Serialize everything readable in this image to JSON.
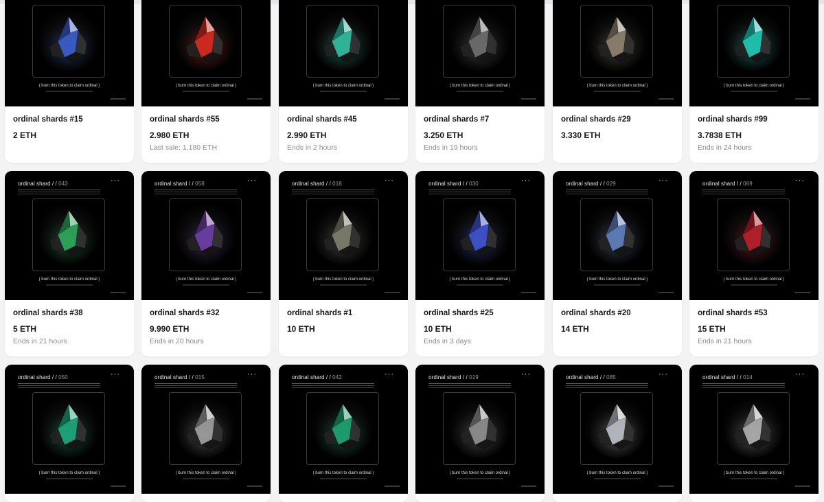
{
  "cards": [
    {
      "name": "ordinal shards #15",
      "price": "2 ETH",
      "sub": "",
      "header": "",
      "num": "",
      "gem": "blue-crystal-image",
      "tint": "#3a5cc4"
    },
    {
      "name": "ordinal shards #55",
      "price": "2.980 ETH",
      "sub": "Last sale: 1.180 ETH",
      "header": "",
      "num": "",
      "gem": "red-crystal-image",
      "tint": "#d12a1f"
    },
    {
      "name": "ordinal shards #45",
      "price": "2.990 ETH",
      "sub": "Ends in 2 hours",
      "header": "",
      "num": "",
      "gem": "teal-crystal-image",
      "tint": "#2fb79a"
    },
    {
      "name": "ordinal shards #7",
      "price": "3.250 ETH",
      "sub": "Ends in 19 hours",
      "header": "",
      "num": "",
      "gem": "black-crystal-image",
      "tint": "#6b6b6b"
    },
    {
      "name": "ordinal shards #29",
      "price": "3.330 ETH",
      "sub": "",
      "header": "",
      "num": "",
      "gem": "stone-crystal-image",
      "tint": "#8a7f6d"
    },
    {
      "name": "ordinal shards #99",
      "price": "3.7838 ETH",
      "sub": "Ends in 24 hours",
      "header": "",
      "num": "",
      "gem": "teal-crystal-image",
      "tint": "#1fc2b0"
    },
    {
      "name": "ordinal shards #38",
      "price": "5 ETH",
      "sub": "Ends in 21 hours",
      "header": "ordinal shard / /",
      "num": "043",
      "gem": "green-crystal-image",
      "tint": "#2ea35a"
    },
    {
      "name": "ordinal shards #32",
      "price": "9.990 ETH",
      "sub": "Ends in 20 hours",
      "header": "ordinal shard / /",
      "num": "058",
      "gem": "purple-crystal-image",
      "tint": "#6a3fa0"
    },
    {
      "name": "ordinal shards #1",
      "price": "10 ETH",
      "sub": "",
      "header": "ordinal shard / /",
      "num": "018",
      "gem": "black-crystal-image",
      "tint": "#7b7b6a"
    },
    {
      "name": "ordinal shards #25",
      "price": "10 ETH",
      "sub": "Ends in 3 days",
      "header": "ordinal shard / /",
      "num": "030",
      "gem": "blue-crystal-image",
      "tint": "#3f52c9"
    },
    {
      "name": "ordinal shards #20",
      "price": "14 ETH",
      "sub": "",
      "header": "ordinal shard / /",
      "num": "029",
      "gem": "blue-crystal-image",
      "tint": "#5f7cb8"
    },
    {
      "name": "ordinal shards #53",
      "price": "15 ETH",
      "sub": "Ends in 21 hours",
      "header": "ordinal shard / /",
      "num": "069",
      "gem": "red-crystal-image",
      "tint": "#b3202a"
    },
    {
      "name": "",
      "price": "",
      "sub": "",
      "header": "ordinal shard / /",
      "num": "050",
      "gem": "green-crystal-image",
      "tint": "#1fa27a"
    },
    {
      "name": "",
      "price": "",
      "sub": "",
      "header": "ordinal shard / /",
      "num": "015",
      "gem": "grey-crystal-image",
      "tint": "#9a9a9a"
    },
    {
      "name": "",
      "price": "",
      "sub": "",
      "header": "ordinal shard / /",
      "num": "042",
      "gem": "green-crystal-image",
      "tint": "#1f9f70"
    },
    {
      "name": "",
      "price": "",
      "sub": "",
      "header": "ordinal shard / /",
      "num": "019",
      "gem": "grey-crystal-image",
      "tint": "#8b8b8b"
    },
    {
      "name": "",
      "price": "",
      "sub": "",
      "header": "ordinal shard / /",
      "num": "085",
      "gem": "grey-crystal-image",
      "tint": "#b6b8c0"
    },
    {
      "name": "",
      "price": "",
      "sub": "",
      "header": "ordinal shard / /",
      "num": "014",
      "gem": "grey-crystal-image",
      "tint": "#aaaaaa"
    }
  ],
  "art_claim": "( burn this token to claim ordinal )",
  "more_icon": "more-icon",
  "dots_glyph": "···"
}
